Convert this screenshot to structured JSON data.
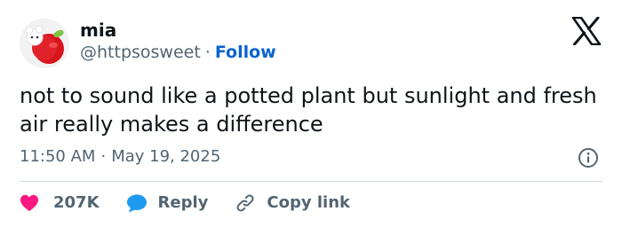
{
  "author": {
    "name": "mia",
    "handle": "@httpsosweet",
    "separator": "·",
    "follow_label": "Follow",
    "avatar_icon": "apple-mascot-avatar"
  },
  "brand": {
    "logo": "x-logo"
  },
  "tweet": {
    "text": "not to sound like a potted plant but sunlight and fresh air really makes a difference",
    "time": "11:50 AM",
    "separator": "·",
    "date": "May 19, 2025"
  },
  "actions": {
    "like_count": "207K",
    "reply_label": "Reply",
    "copy_link_label": "Copy link"
  },
  "colors": {
    "like": "#f91880",
    "reply": "#1d9bf0",
    "link": "#0b63ce",
    "secondary_text": "#536471"
  }
}
